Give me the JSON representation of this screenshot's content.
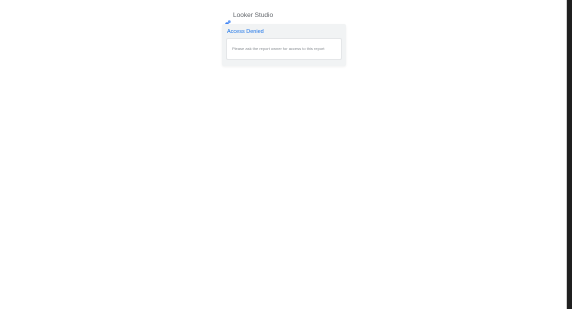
{
  "app": {
    "brand_name": "Looker Studio",
    "logo_icon": "looker-studio-logo-icon",
    "logo_colors": [
      "#4285f4",
      "#669df6"
    ]
  },
  "card": {
    "title": "Access Denied",
    "message": "Please ask the report owner for access to this report"
  },
  "colors": {
    "page_background": "#ffffff",
    "card_background": "#f1f3f4",
    "link_blue": "#1a73e8",
    "scrollbar": "#1f1f1f"
  }
}
